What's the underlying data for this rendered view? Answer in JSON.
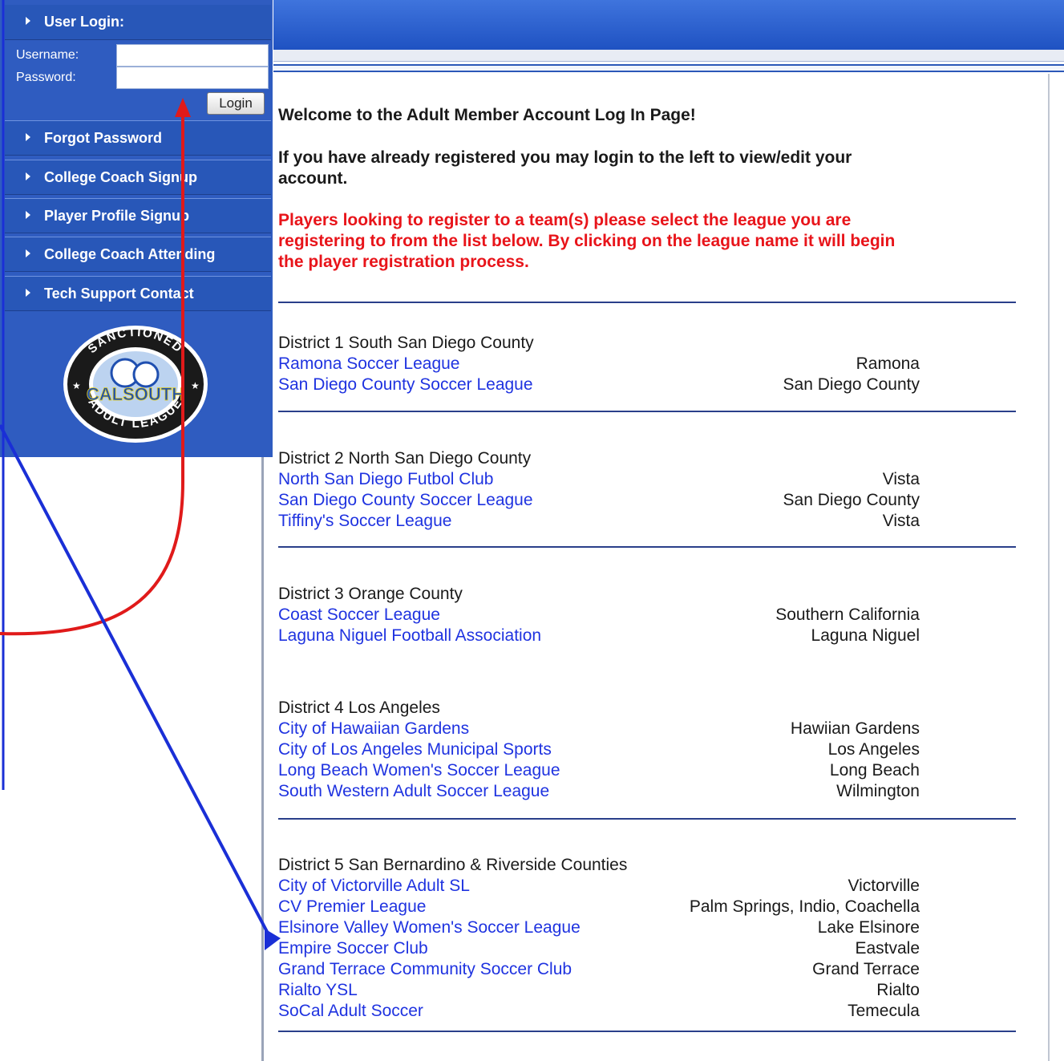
{
  "sidebar": {
    "login_title": "User Login:",
    "username_label": "Username:",
    "password_label": "Password:",
    "username_value": "",
    "password_value": "",
    "login_button": "Login",
    "items": [
      {
        "label": "Forgot Password"
      },
      {
        "label": "College Coach Signup"
      },
      {
        "label": "Player Profile Signup"
      },
      {
        "label": "College Coach Attending"
      },
      {
        "label": "Tech Support Contact"
      }
    ],
    "logo": {
      "ring_text_top": "SANCTIONED",
      "ring_text_bottom": "ADULT LEAGUE",
      "center_text": "CALSOUTH"
    }
  },
  "main": {
    "welcome": "Welcome to the Adult Member Account Log In Page!",
    "info_line1": "If you have already registered you may login to the left to view/edit your",
    "info_line2": "account.",
    "red_line1": "Players looking to register to a team(s) please select the league you are",
    "red_line2": "registering to from the list below.  By clicking on the league name it will begin",
    "red_line3": "the player registration process.",
    "districts": [
      {
        "title": "District 1  South San Diego County",
        "leagues": [
          {
            "name": "Ramona Soccer League",
            "city": "Ramona"
          },
          {
            "name": "San Diego County Soccer League",
            "city": "San Diego County"
          }
        ]
      },
      {
        "title": "District 2 North San Diego County",
        "leagues": [
          {
            "name": "North San Diego Futbol Club",
            "city": "Vista"
          },
          {
            "name": "San Diego County Soccer League",
            "city": "San Diego County"
          },
          {
            "name": "Tiffiny's Soccer League",
            "city": "Vista"
          }
        ]
      },
      {
        "title": "District 3 Orange County",
        "leagues": [
          {
            "name": "Coast Soccer League",
            "city": "Southern California"
          },
          {
            "name": "Laguna Niguel Football Association",
            "city": "Laguna Niguel"
          }
        ]
      },
      {
        "title": "District 4 Los Angeles",
        "leagues": [
          {
            "name": "City of Hawaiian Gardens",
            "city": "Hawiian Gardens"
          },
          {
            "name": "City of Los Angeles Municipal Sports",
            "city": "Los Angeles"
          },
          {
            "name": "Long Beach Women's Soccer League",
            "city": "Long Beach"
          },
          {
            "name": "South Western Adult Soccer League",
            "city": "Wilmington"
          }
        ]
      },
      {
        "title": "District 5  San Bernardino & Riverside Counties",
        "leagues": [
          {
            "name": "City of Victorville Adult SL",
            "city": "Victorville"
          },
          {
            "name": "CV Premier League",
            "city": "Palm Springs, Indio, Coachella"
          },
          {
            "name": "Elsinore Valley Women's Soccer League",
            "city": "Lake Elsinore"
          },
          {
            "name": "Empire Soccer Club",
            "city": "Eastvale"
          },
          {
            "name": "Grand Terrace Community Soccer Club",
            "city": "Grand Terrace"
          },
          {
            "name": "Rialto YSL",
            "city": "Rialto"
          },
          {
            "name": "SoCal Adult Soccer",
            "city": "Temecula"
          }
        ]
      }
    ]
  },
  "colors": {
    "sidebar_blue": "#2f5cc0",
    "link_blue": "#1f33e0",
    "notice_red": "#e8141a",
    "arrow_red": "#e01a1a",
    "arrow_blue": "#1a2fd6"
  }
}
